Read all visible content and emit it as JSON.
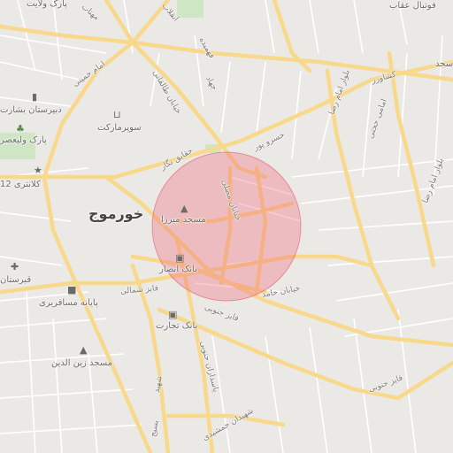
{
  "map": {
    "city_label": "خورموج",
    "colors": {
      "background": "#ebe9e6",
      "major_road": "#f8d88a",
      "minor_road": "#ffffff",
      "highlight_fill": "#f26b7c",
      "highlight_stroke": "#e0606f",
      "park": "#cfe6c4"
    },
    "places": [
      {
        "label": "پارک ولایت",
        "icon": "none"
      },
      {
        "label": "دبیرستان بشارت",
        "icon": "school-icon"
      },
      {
        "label": "پارک ولیعصر",
        "icon": "park-tree-icon"
      },
      {
        "label": "کلانتری 12",
        "icon": "police-icon"
      },
      {
        "label": "سوپرمارکت",
        "icon": "shopping-cart-icon"
      },
      {
        "label": "مسجد میرزا",
        "icon": "mosque-icon"
      },
      {
        "label": "بانک انصار",
        "icon": "bank-icon"
      },
      {
        "label": "بانک تجارت",
        "icon": "bank-icon"
      },
      {
        "label": "پایانه مسافربری",
        "icon": "bus-icon"
      },
      {
        "label": "قبرستان",
        "icon": "cemetery-icon"
      },
      {
        "label": "مسجد زین الدین",
        "icon": "mosque-icon"
      },
      {
        "label": "فوتبال عقاب",
        "icon": "none"
      },
      {
        "label": "سجد",
        "icon": "none"
      }
    ],
    "streets": [
      "امام خمینی",
      "مهتاب",
      "انقلاب",
      "فهمیده",
      "جهاد",
      "خیابان طالقانی",
      "حقایق نگار",
      "خسرو پور",
      "خیابان مصلی",
      "خیابان حامد",
      "فایز شمالی",
      "فایز جنوبی",
      "فایز جنوبی",
      "بلوار امام رضا",
      "بلوار امام رضا",
      "امامی حجتی",
      "کشاورز",
      "پاسداران جنوبی",
      "شهیدان جمشیدی",
      "شهید",
      "بسیج"
    ]
  }
}
